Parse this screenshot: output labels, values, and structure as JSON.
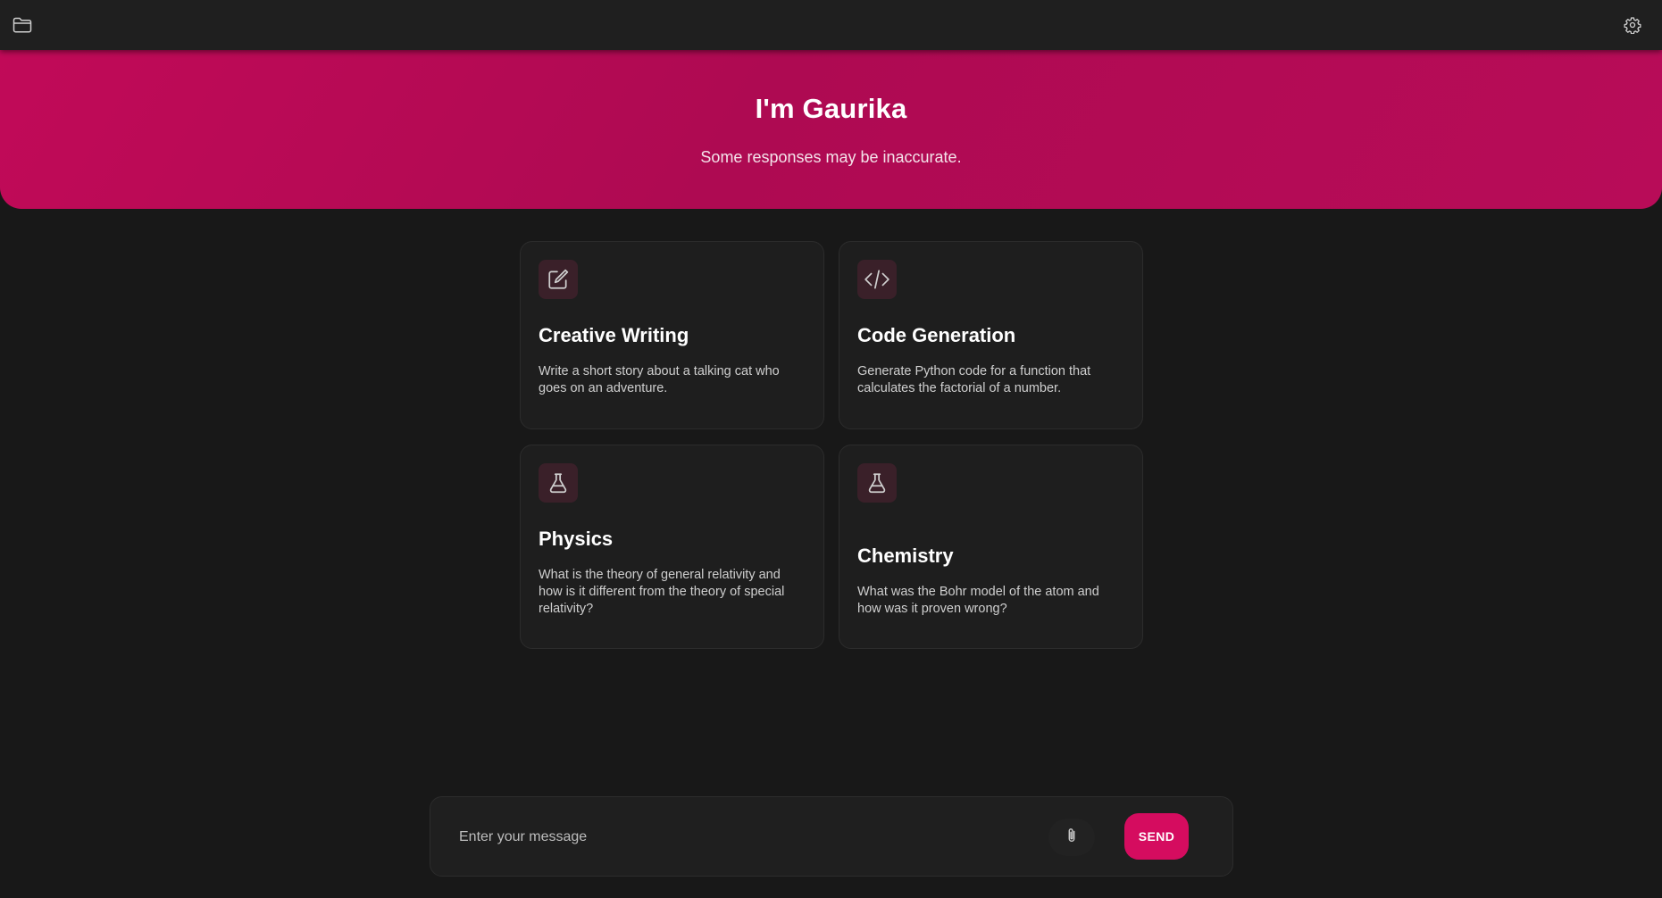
{
  "app": {
    "title": "I'm Gaurika",
    "subtitle": "Some responses may be inaccurate."
  },
  "topbar": {
    "left_icon": "folder-icon",
    "right_icon": "gear-icon"
  },
  "cards": [
    {
      "icon": "edit-icon",
      "title": "Creative Writing",
      "description": "Write a short story about a talking cat who goes on an adventure."
    },
    {
      "icon": "code-icon",
      "title": "Code Generation",
      "description": "Generate Python code for a function that calculates the factorial of a number."
    },
    {
      "icon": "flask-icon",
      "title": "Physics",
      "description": "What is the theory of general relativity and how is it different from the theory of special relativity?"
    },
    {
      "icon": "flask-icon",
      "title": "Chemistry",
      "description": "What was the Bohr model of the atom and how was it proven wrong?"
    }
  ],
  "composer": {
    "placeholder": "Enter your message",
    "value": "",
    "attach_icon": "paperclip-icon",
    "send_label": "SEND"
  },
  "colors": {
    "accent": "#d50c5f",
    "hero_gradient": "#c10a58",
    "background": "#181818",
    "card_background": "#1e1e1e",
    "icon_badge": "#3a2029"
  }
}
